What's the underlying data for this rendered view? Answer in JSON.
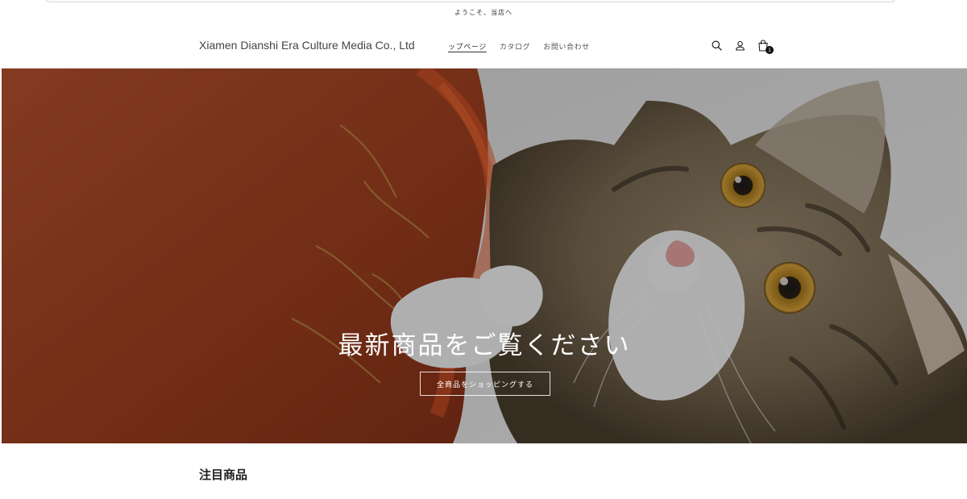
{
  "announcement": {
    "text": "ようこそ、当店へ"
  },
  "header": {
    "brand": "Xiamen Dianshi Era Culture Media Co., Ltd",
    "nav": [
      {
        "label": "ップページ"
      },
      {
        "label": "カタログ"
      },
      {
        "label": "お問い合わせ"
      }
    ],
    "icons": {
      "search": "search-icon",
      "account": "user-icon",
      "cart": "shopping-bag-icon"
    },
    "cart_count": "1"
  },
  "hero": {
    "title": "最新商品をご覧ください",
    "cta": "全商品をショッピングする"
  },
  "featured": {
    "title": "注目商品"
  },
  "colors": {
    "accent": "#111111",
    "hero_text": "#ffffff"
  }
}
